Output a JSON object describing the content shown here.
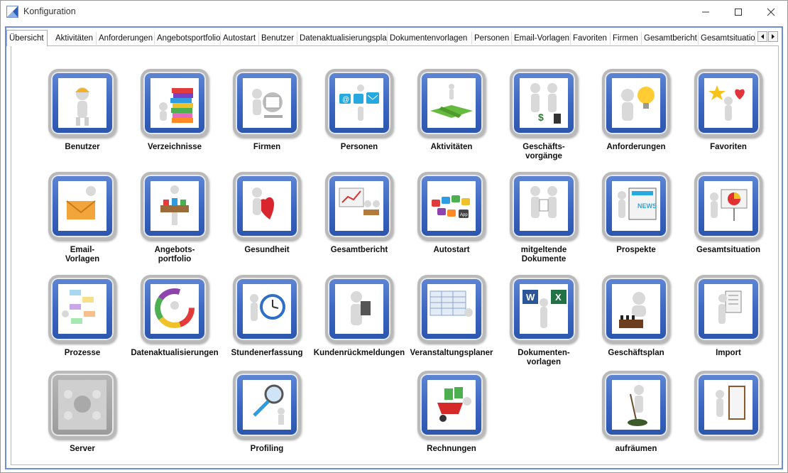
{
  "window": {
    "title": "Konfiguration"
  },
  "tabs": [
    "Übersicht",
    "Aktivitäten",
    "Anforderungen",
    "Angebotsportfolio",
    "Autostart",
    "Benutzer",
    "Datenaktualisierungsplan",
    "Dokumentenvorlagen",
    "Personen",
    "Email-Vorlagen",
    "Favoriten",
    "Firmen",
    "Gesamtbericht",
    "Gesamtsituation"
  ],
  "active_tab": "Übersicht",
  "tiles": [
    {
      "label": "Benutzer",
      "icon": "worker-helmet-icon"
    },
    {
      "label": "Verzeichnisse",
      "icon": "books-stack-icon"
    },
    {
      "label": "Firmen",
      "icon": "rolodex-icon"
    },
    {
      "label": "Personen",
      "icon": "contact-channels-icon"
    },
    {
      "label": "Aktivitäten",
      "icon": "crossroads-icon"
    },
    {
      "label": "Geschäfts-\nvorgänge",
      "icon": "handshake-icon"
    },
    {
      "label": "Anforderungen",
      "icon": "light-bulb-icon"
    },
    {
      "label": "Favoriten",
      "icon": "star-heart-icon"
    },
    {
      "label": "Email-\nVorlagen",
      "icon": "envelope-icon"
    },
    {
      "label": "Angebots-\nportfolio",
      "icon": "tray-icon"
    },
    {
      "label": "Gesundheit",
      "icon": "heart-icon"
    },
    {
      "label": "Gesamtbericht",
      "icon": "presentation-icon"
    },
    {
      "label": "Autostart",
      "icon": "app-keys-icon"
    },
    {
      "label": "mitgeltende\nDokumente",
      "icon": "document-handover-icon"
    },
    {
      "label": "Prospekte",
      "icon": "newspaper-icon"
    },
    {
      "label": "Gesamtsituation",
      "icon": "pie-board-icon"
    },
    {
      "label": "Prozesse",
      "icon": "flowchart-icon"
    },
    {
      "label": "Datenaktualisierungen",
      "icon": "color-cycle-icon"
    },
    {
      "label": "Stundenerfassung",
      "icon": "alarm-clock-icon"
    },
    {
      "label": "Kundenrückmeldungen",
      "icon": "clipboard-icon"
    },
    {
      "label": "Veranstaltungsplaner",
      "icon": "calendar-grid-icon"
    },
    {
      "label": "Dokumenten-\nvorlagen",
      "icon": "word-excel-icon"
    },
    {
      "label": "Geschäftsplan",
      "icon": "chess-icon"
    },
    {
      "label": "Import",
      "icon": "import-list-icon"
    },
    {
      "label": "Server",
      "icon": "network-people-icon"
    },
    {
      "label": "Profiling",
      "icon": "magnifier-icon"
    },
    {
      "label": "Rechnungen",
      "icon": "money-wheelbarrow-icon"
    },
    {
      "label": "aufräumen",
      "icon": "broom-icon"
    },
    {
      "label": "",
      "icon": "exit-door-icon"
    }
  ]
}
